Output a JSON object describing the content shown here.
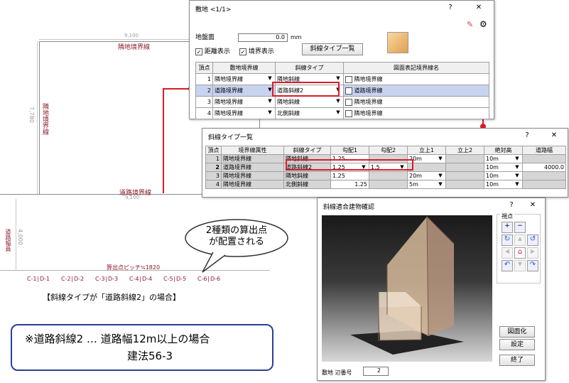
{
  "drawing": {
    "dim_top": "9,100",
    "label_top": "隣地境界線",
    "dim_left": "7,780",
    "label_left": "隣地境界線",
    "label_road": "道路境界線",
    "dim_road": "9,100",
    "label_road_width": "道路幅員",
    "dim_road_width": "4,000",
    "pitch_label": "算出点ピッチ≒1820",
    "points": [
      "C-1",
      "D-1",
      "C-2",
      "D-2",
      "C-3",
      "D-3",
      "C-4",
      "D-4",
      "C-5",
      "D-5",
      "C-6",
      "D-6"
    ]
  },
  "bubble": {
    "line1": "2種類の算出点",
    "line2": "が配置される"
  },
  "caption": "【斜線タイプが「道路斜線2」の場合】",
  "note": {
    "line1": "※道路斜線2 … 道路幅12m以上の場合",
    "line2": "建法56-3"
  },
  "site_dialog": {
    "title": "敷地 <1/1>",
    "help": "?",
    "close": "✕",
    "ground_label": "地盤面",
    "ground_value": "0.0",
    "ground_unit": "mm",
    "chk_distance": "距離表示",
    "chk_boundary": "境界表示",
    "list_button": "斜線タイプ一覧",
    "headers": [
      "頂点",
      "敷地境界線",
      "斜線タイプ",
      "図面表記境界線名"
    ],
    "rows": [
      {
        "no": "1",
        "boundary": "隣地境界線",
        "type": "隣地斜線",
        "name": "隣地境界線"
      },
      {
        "no": "2",
        "boundary": "道路境界線",
        "type": "道路斜線2",
        "name": "道路境界線"
      },
      {
        "no": "3",
        "boundary": "隣地境界線",
        "type": "隣地斜線",
        "name": "隣地境界線"
      },
      {
        "no": "4",
        "boundary": "隣地境界線",
        "type": "北側斜線",
        "name": "隣地境界線"
      }
    ]
  },
  "list_dialog": {
    "title": "斜線タイプ一覧",
    "help": "?",
    "close": "✕",
    "headers": [
      "頂点",
      "境界線属性",
      "斜線タイプ",
      "勾配1",
      "勾配2",
      "立上1",
      "立上2",
      "絶対高",
      "道路幅"
    ],
    "rows": [
      {
        "no": "1",
        "attr": "隣地境界線",
        "type": "隣地斜線",
        "g1": "1.25",
        "g2": "",
        "r1": "20m",
        "r2": "",
        "abs": "10m",
        "road": ""
      },
      {
        "no": "2",
        "attr": "道路境界線",
        "type": "道路斜線2",
        "g1": "1.25",
        "g2": "1.5",
        "r1": "",
        "r2": "",
        "abs": "10m",
        "road": "4000.0"
      },
      {
        "no": "3",
        "attr": "隣地境界線",
        "type": "隣地斜線",
        "g1": "1.25",
        "g2": "",
        "r1": "20m",
        "r2": "",
        "abs": "10m",
        "road": ""
      },
      {
        "no": "4",
        "attr": "隣地境界線",
        "type": "北側斜線",
        "g1": "1.25",
        "g2": "",
        "r1": "5m",
        "r2": "",
        "abs": "10m",
        "road": ""
      }
    ]
  },
  "check_dialog": {
    "title": "斜線適合建物確認",
    "help": "?",
    "close": "✕",
    "viewpoint_label": "視点",
    "btn_figure": "図面化",
    "btn_settings": "設定",
    "btn_finish": "終了",
    "edge_label": "敷地 辺番号",
    "edge_value": "2"
  },
  "colors": {
    "accent_red": "#d91c28",
    "drawing_red": "#8b1a2b",
    "note_border": "#2c3e9a"
  }
}
